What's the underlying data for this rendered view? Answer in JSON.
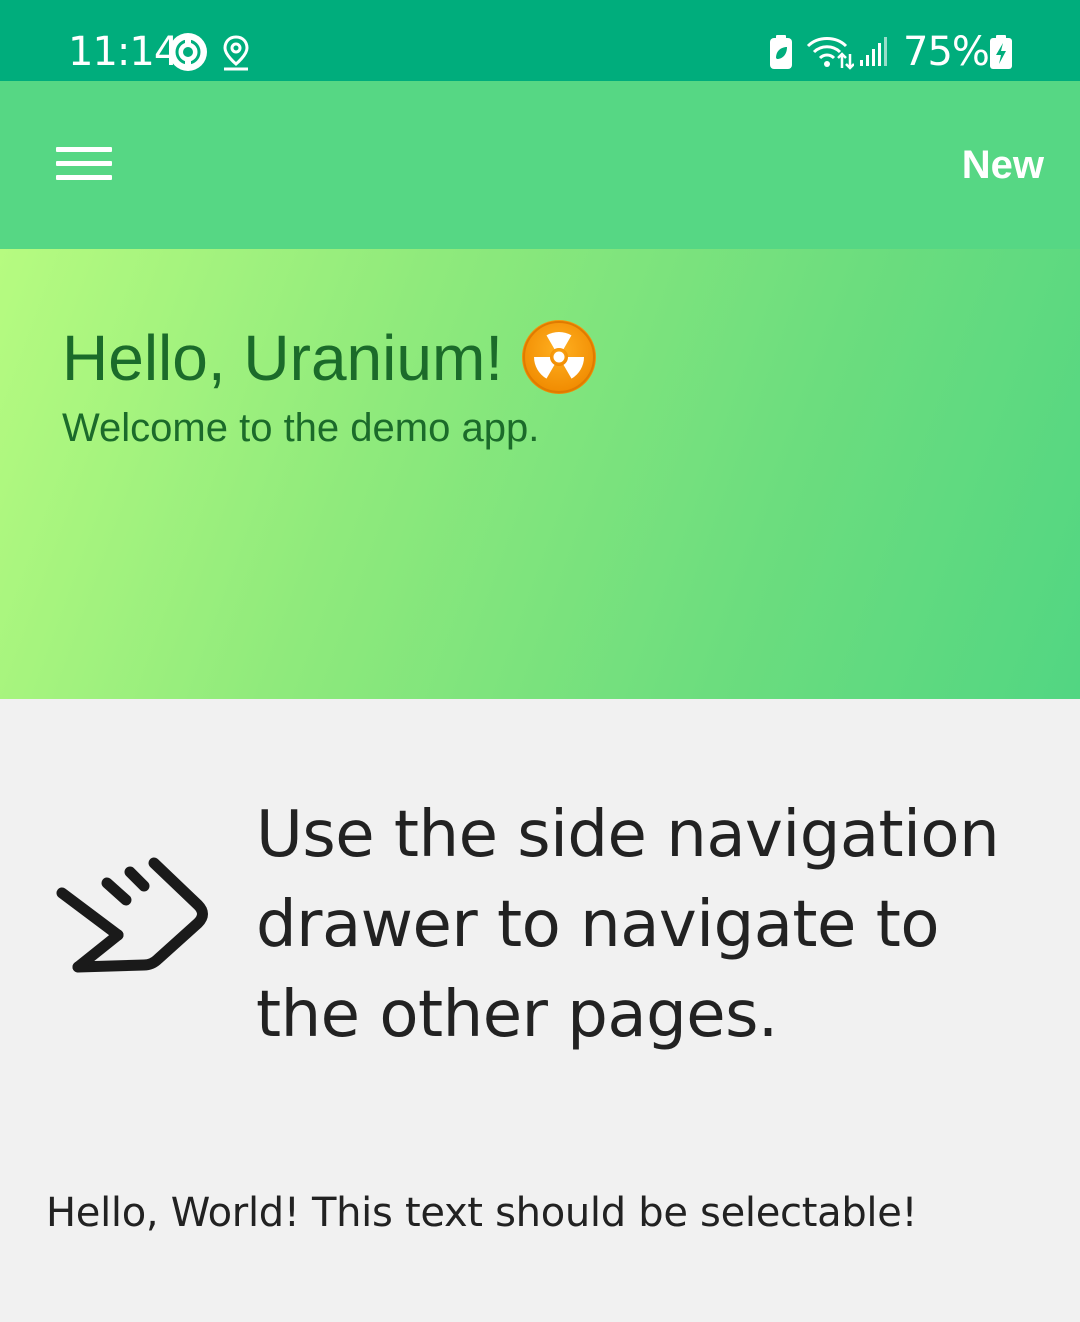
{
  "status_bar": {
    "time": "11:14",
    "battery_percent": "75%",
    "icons": [
      "sync-icon",
      "location-icon",
      "battery-saver-icon",
      "wifi-icon",
      "signal-icon",
      "battery-charging-icon"
    ]
  },
  "app_bar": {
    "menu_icon": "hamburger-menu-icon",
    "action_label": "New"
  },
  "hero": {
    "title": "Hello, Uranium!",
    "title_icon": "radiation-icon",
    "subtitle": "Welcome to the demo app.",
    "gradient": [
      "#b6fb80",
      "#52d682"
    ]
  },
  "content": {
    "hint_icon": "swipe-right-icon",
    "nav_hint": "Use the side navigation drawer to navigate to the other pages.",
    "selectable_text": "Hello, World! This text should be selectable!"
  },
  "colors": {
    "status_bar": "#00ad7c",
    "app_bar": "#56d784",
    "hero_text": "#1b6b2a",
    "background": "#f1f1f1"
  }
}
